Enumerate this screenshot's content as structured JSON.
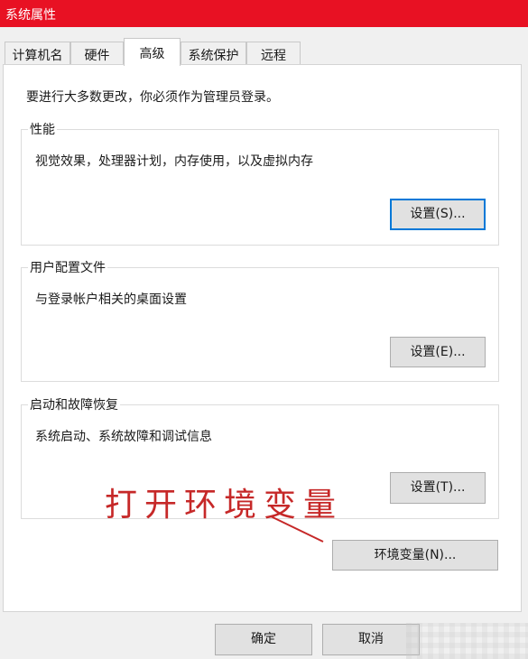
{
  "window": {
    "title": "系统属性"
  },
  "tabs": [
    {
      "label": "计算机名",
      "active": false
    },
    {
      "label": "硬件",
      "active": false
    },
    {
      "label": "高级",
      "active": true
    },
    {
      "label": "系统保护",
      "active": false
    },
    {
      "label": "远程",
      "active": false
    }
  ],
  "advanced": {
    "admin_note": "要进行大多数更改，你必须作为管理员登录。",
    "performance": {
      "title": "性能",
      "description": "视觉效果，处理器计划，内存使用，以及虚拟内存",
      "button_label": "设置(S)..."
    },
    "user_profiles": {
      "title": "用户配置文件",
      "description": "与登录帐户相关的桌面设置",
      "button_label": "设置(E)..."
    },
    "startup_recovery": {
      "title": "启动和故障恢复",
      "description": "系统启动、系统故障和调试信息",
      "button_label": "设置(T)..."
    },
    "env_vars_button_label": "环境变量(N)..."
  },
  "annotation": {
    "text": "打开环境变量",
    "color": "#c62828"
  },
  "footer": {
    "ok_label": "确定",
    "cancel_label": "取消"
  },
  "colors": {
    "titlebar": "#e81123",
    "focus": "#0078d7"
  }
}
